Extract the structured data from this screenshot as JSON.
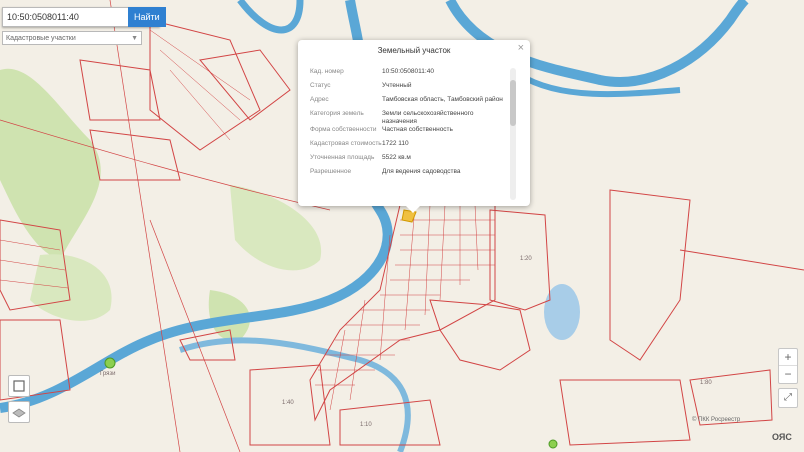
{
  "search": {
    "value": "10:50:0508011:40",
    "button_label": "Найти"
  },
  "layer_select": {
    "value": "Кадастровые участки"
  },
  "popup": {
    "title": "Земельный участок",
    "rows": [
      {
        "key": "Кад. номер",
        "value": "10:50:0508011:40"
      },
      {
        "key": "Статус",
        "value": "Учтенный"
      },
      {
        "key": "Адрес",
        "value": "Тамбовская область, Тамбовский район"
      },
      {
        "key": "Категория земель",
        "value": "Земли сельскохозяйственного назначения"
      },
      {
        "key": "Форма собственности",
        "value": "Частная собственность"
      },
      {
        "key": "Кадастровая стоимость",
        "value": "1722 110"
      },
      {
        "key": "Уточненная площадь",
        "value": "5522 кв.м"
      },
      {
        "key": "Разрешенное",
        "value": "Для ведения садоводства"
      }
    ]
  },
  "controls": {
    "zoom_in": "+",
    "zoom_out": "−",
    "fit": "⤢"
  },
  "map_labels": [
    "Грязи",
    "1:40",
    "1:10",
    "1:20",
    "1:80"
  ],
  "attribution": "© ПКК Росреестр",
  "watermark": "ОЯС",
  "colors": {
    "parcel_line": "#d24545",
    "water": "#5aa7d6",
    "land": "#f3efe6",
    "green": "#cfe3b0",
    "button": "#2f80d1"
  }
}
